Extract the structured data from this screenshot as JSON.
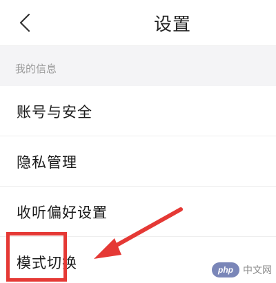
{
  "nav": {
    "title": "设置",
    "back_icon": "chevron-left-icon"
  },
  "section": {
    "header": "我的信息"
  },
  "list": {
    "items": [
      {
        "label": "账号与安全"
      },
      {
        "label": "隐私管理"
      },
      {
        "label": "收听偏好设置"
      },
      {
        "label": "模式切换"
      }
    ]
  },
  "annotation": {
    "color": "#e53935"
  },
  "watermark": {
    "logo": "php",
    "text": "中文网"
  }
}
